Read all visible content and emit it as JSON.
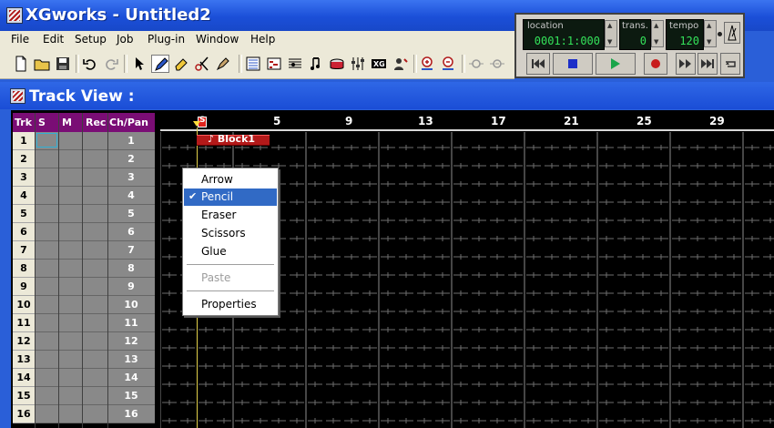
{
  "window": {
    "title": "XGworks - Untitled2"
  },
  "menu": {
    "items": [
      "File",
      "Edit",
      "Setup",
      "Job",
      "Plug-in",
      "Window",
      "Help"
    ]
  },
  "toolbar": {
    "buttons": [
      "new-file-icon",
      "open-folder-icon",
      "save-icon",
      "undo-icon",
      "redo-icon",
      "arrow-tool-icon",
      "pencil-tool-icon",
      "eraser-tool-icon",
      "scissors-tool-icon",
      "glue-tool-icon",
      "list-view-icon",
      "piano-roll-icon",
      "staff-view-icon",
      "score-icon",
      "drum-icon",
      "mixer-icon",
      "xg-editor-icon",
      "voice-icon",
      "zoom-in-icon",
      "zoom-out-icon",
      "snap-icon",
      "quantize-icon"
    ]
  },
  "transport": {
    "location_label": "location",
    "location_value": "0001:1:000",
    "trans_label": "trans.",
    "trans_value": "0",
    "tempo_label": "tempo",
    "tempo_value": "120"
  },
  "track_view": {
    "title": "Track View :",
    "columns": [
      "Trk",
      "S",
      "M",
      "Rec",
      "Ch/Pan"
    ],
    "rows": [
      {
        "trk": "1",
        "ch": "1"
      },
      {
        "trk": "2",
        "ch": "2"
      },
      {
        "trk": "3",
        "ch": "3"
      },
      {
        "trk": "4",
        "ch": "4"
      },
      {
        "trk": "5",
        "ch": "5"
      },
      {
        "trk": "6",
        "ch": "6"
      },
      {
        "trk": "7",
        "ch": "7"
      },
      {
        "trk": "8",
        "ch": "8"
      },
      {
        "trk": "9",
        "ch": "9"
      },
      {
        "trk": "10",
        "ch": "10"
      },
      {
        "trk": "11",
        "ch": "11"
      },
      {
        "trk": "12",
        "ch": "12"
      },
      {
        "trk": "13",
        "ch": "13"
      },
      {
        "trk": "14",
        "ch": "14"
      },
      {
        "trk": "15",
        "ch": "15"
      },
      {
        "trk": "16",
        "ch": "16"
      }
    ],
    "ruler": [
      "5",
      "9",
      "13",
      "17",
      "21",
      "25",
      "29"
    ],
    "block_label": "♪ Block1",
    "location_marker": "S"
  },
  "context_menu": {
    "items": [
      {
        "label": "Arrow",
        "checked": false,
        "disabled": false
      },
      {
        "label": "Pencil",
        "checked": true,
        "disabled": false
      },
      {
        "label": "Eraser",
        "checked": false,
        "disabled": false
      },
      {
        "label": "Scissors",
        "checked": false,
        "disabled": false
      },
      {
        "label": "Glue",
        "checked": false,
        "disabled": false
      },
      {
        "label": "Paste",
        "checked": false,
        "disabled": true
      },
      {
        "label": "Properties",
        "checked": false,
        "disabled": false
      }
    ]
  },
  "colors": {
    "title_bar": "#1b4fd8",
    "track_header": "#7a0d75",
    "block": "#b31919",
    "selection": "#316ac5",
    "lcd_text": "#34e25a"
  }
}
